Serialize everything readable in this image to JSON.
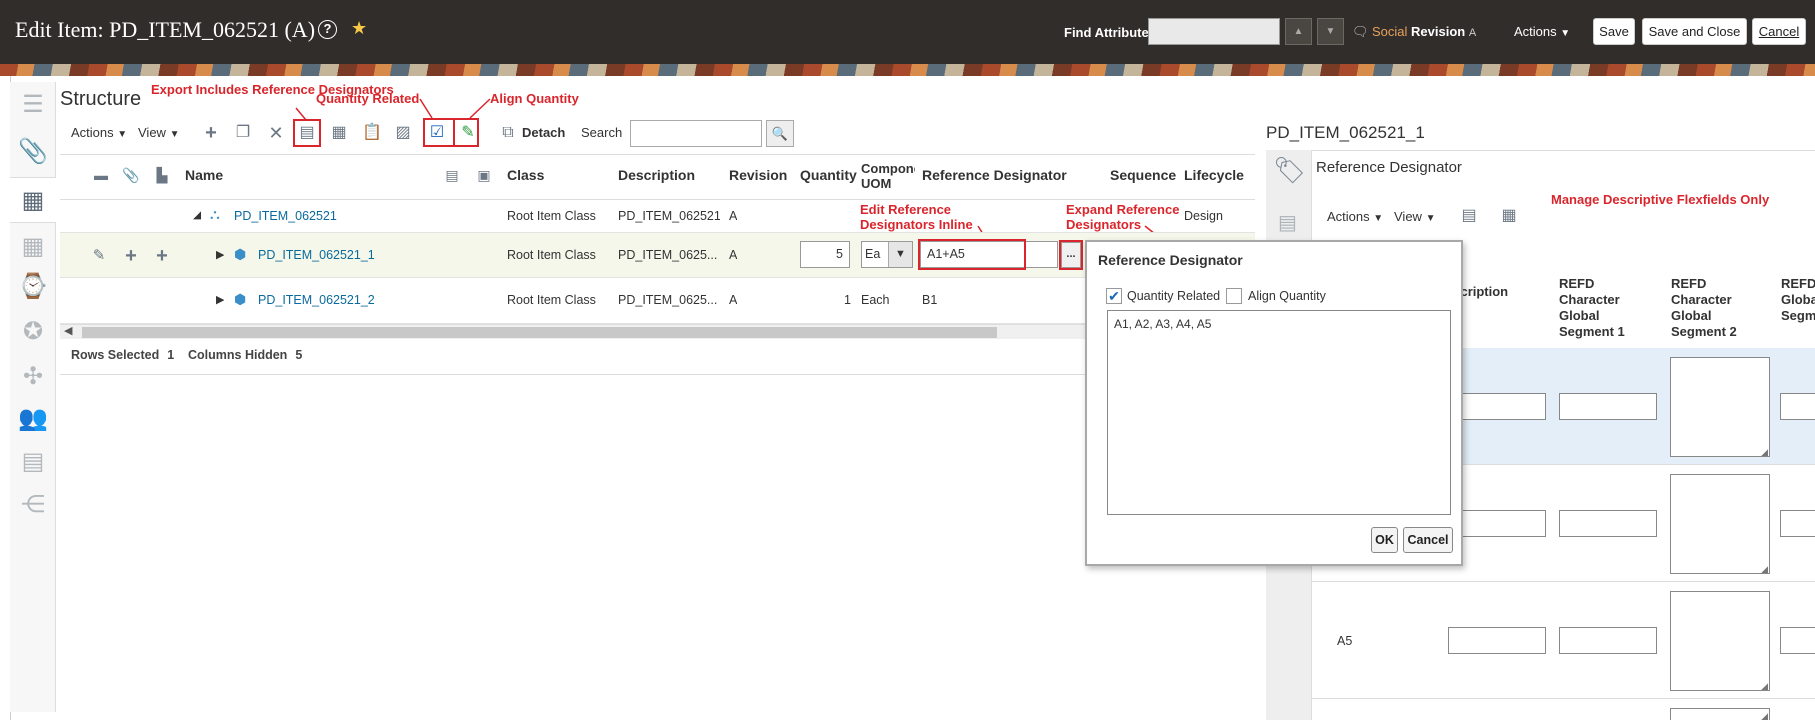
{
  "header": {
    "title": "Edit Item: PD_ITEM_062521 (A)",
    "find_label": "Find Attribute",
    "find_value": "",
    "social_prefix": "Social",
    "social_label": "Revision",
    "social_suffix": "A",
    "actions_label": "Actions",
    "save_label": "Save",
    "save_close_label": "Save and Close",
    "cancel_label": "Cancel"
  },
  "structure": {
    "title": "Structure",
    "actions_label": "Actions",
    "view_label": "View",
    "detach_label": "Detach",
    "search_label": "Search",
    "search_value": ""
  },
  "callouts": {
    "export": "Export Includes Reference Designators",
    "qty_related": "Quantity Related",
    "align_qty": "Align Quantity",
    "edit_inline": "Edit Reference Designators Inline",
    "expand": "Expand Reference Designators",
    "manage_dff": "Manage Descriptive Flexfields Only"
  },
  "table": {
    "columns": {
      "name": "Name",
      "class": "Class",
      "description": "Description",
      "revision": "Revision",
      "quantity": "Quantity",
      "component_uom_1": "Compone",
      "component_uom_2": "UOM",
      "reference_designator": "Reference Designator",
      "sequence": "Sequence",
      "lifecycle": "Lifecycle"
    },
    "rows": [
      {
        "name": "PD_ITEM_062521",
        "class": "Root Item Class",
        "description": "PD_ITEM_062521",
        "revision": "A",
        "quantity": "",
        "uom": "",
        "refd": "",
        "lifecycle": "Design"
      },
      {
        "name": "PD_ITEM_062521_1",
        "class": "Root Item Class",
        "description": "PD_ITEM_0625...",
        "revision": "A",
        "quantity": "5",
        "uom": "Ea",
        "refd": "A1+A5",
        "lifecycle": ""
      },
      {
        "name": "PD_ITEM_062521_2",
        "class": "Root Item Class",
        "description": "PD_ITEM_0625...",
        "revision": "A",
        "quantity": "1",
        "uom": "Each",
        "refd": "B1",
        "lifecycle": ""
      }
    ],
    "status": {
      "rows_selected_label": "Rows Selected",
      "rows_selected": "1",
      "columns_hidden_label": "Columns Hidden",
      "columns_hidden": "5"
    }
  },
  "right_panel": {
    "title": "PD_ITEM_062521_1",
    "section": "Reference Designator",
    "actions_label": "Actions",
    "view_label": "View",
    "columns": {
      "description": "escription",
      "seg1": "REFD Character Global Segment 1",
      "seg2": "REFD Character Global Segment 2",
      "seg3": "REFD Globa Segm"
    },
    "row_label_a5": "A5"
  },
  "popup": {
    "title": "Reference Designator",
    "quantity_related_label": "Quantity Related",
    "quantity_related_checked": true,
    "align_quantity_label": "Align Quantity",
    "align_quantity_checked": false,
    "text": "A1, A2, A3, A4, A5",
    "ok_label": "OK",
    "cancel_label": "Cancel"
  },
  "colors": {
    "header_bg": "#312d2a",
    "accent_red": "#d9262c",
    "link": "#0b6a9c",
    "selected_row": "#f4f7ea",
    "right_row_selected": "#e3eef8"
  }
}
